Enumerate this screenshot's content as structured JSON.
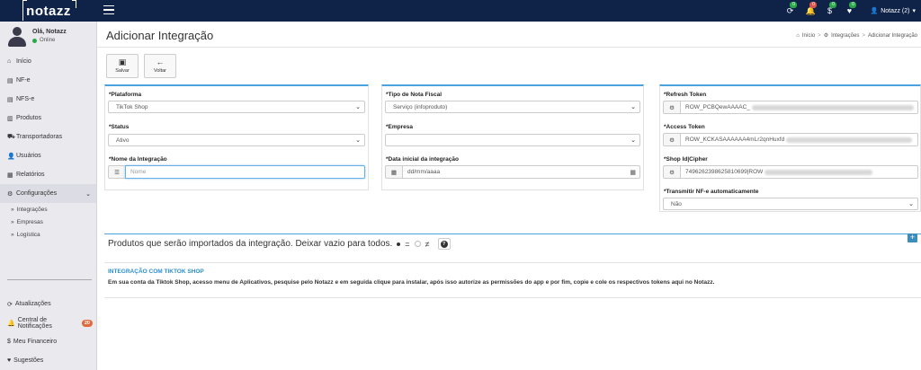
{
  "app": {
    "logo": "notazz"
  },
  "topbar": {
    "icons": [
      {
        "name": "sync-icon",
        "glyph": "⟳",
        "badge": "0",
        "badge_color": "#2aa84a"
      },
      {
        "name": "bell-icon",
        "glyph": "🔔",
        "badge": "0",
        "badge_color": "#d9534f"
      },
      {
        "name": "dollar-icon",
        "glyph": "$",
        "badge": "0",
        "badge_color": "#2aa84a"
      },
      {
        "name": "heart-icon",
        "glyph": "♥",
        "badge": "0",
        "badge_color": "#2aa84a"
      }
    ],
    "user_label": "Notazz (2)"
  },
  "sidebar": {
    "greeting": "Olá, Notazz",
    "status": "Online",
    "menu": [
      {
        "icon": "⌂",
        "label": "Início"
      },
      {
        "icon": "▤",
        "label": "NF-e"
      },
      {
        "icon": "▤",
        "label": "NFS-e"
      },
      {
        "icon": "▥",
        "label": "Produtos"
      },
      {
        "icon": "⛟",
        "label": "Transportadoras"
      },
      {
        "icon": "👤",
        "label": "Usuários"
      },
      {
        "icon": "▦",
        "label": "Relatórios"
      },
      {
        "icon": "⚙",
        "label": "Configurações"
      }
    ],
    "submenu": [
      "Integrações",
      "Empresas",
      "Logística"
    ],
    "menu2": [
      {
        "icon": "⟳",
        "label": "Atualizações"
      },
      {
        "icon": "🔔",
        "label": "Central de Notificações",
        "badge": "20"
      },
      {
        "icon": "$",
        "label": "Meu Financeiro"
      },
      {
        "icon": "♥",
        "label": "Sugestões"
      }
    ]
  },
  "page": {
    "title": "Adicionar Integração",
    "breadcrumb": [
      "Início",
      "Integrações",
      "Adicionar Integração"
    ]
  },
  "toolbar": {
    "save_label": "Salvar",
    "back_label": "Voltar"
  },
  "form_left": {
    "platform_label": "*Plataforma",
    "platform_value": "TikTok Shop",
    "status_label": "*Status",
    "status_value": "Ativo",
    "name_label": "*Nome da Integração",
    "name_placeholder": "Nome"
  },
  "form_middle": {
    "invoice_type_label": "*Tipo de Nota Fiscal",
    "invoice_type_value": "Serviço (infoproduto)",
    "company_label": "*Empresa",
    "company_value": "",
    "start_date_label": "*Data inicial da integração",
    "start_date_placeholder": "dd/mm/aaaa"
  },
  "form_right": {
    "refresh_token_label": "*Refresh Token",
    "refresh_token_value": "ROW_PCBQewAAAAC_",
    "access_token_label": "*Access Token",
    "access_token_value": "ROW_KCKASAAAAAA4mLr2qnHuxfd",
    "shop_id_label": "*Shop Id|Cipher",
    "shop_id_value": "7496262398625810699|ROW",
    "transmit_label": "*Transmitir NF-e automaticamente",
    "transmit_value": "Não"
  },
  "products": {
    "text": "Produtos que serão importados da integração. Deixar vazio para todos.",
    "equals_label": "=",
    "not_equals_label": "≠",
    "help_label": "?",
    "add_label": "+"
  },
  "info": {
    "title": "INTEGRAÇÃO COM TIKTOK SHOP",
    "body": "Em sua conta da Tiktok Shop, acesso menu de Aplicativos, pesquise pelo Notazz e em seguida clique para instalar, após isso autorize as permissões do app e por fim, copie e cole os respectivos tokens aqui no Notazz."
  },
  "colors": {
    "topbar": "#0e2347",
    "panel_accent": "#4aa3df",
    "info_title": "#2a8fd0",
    "notif_badge": "#e06a3b"
  }
}
